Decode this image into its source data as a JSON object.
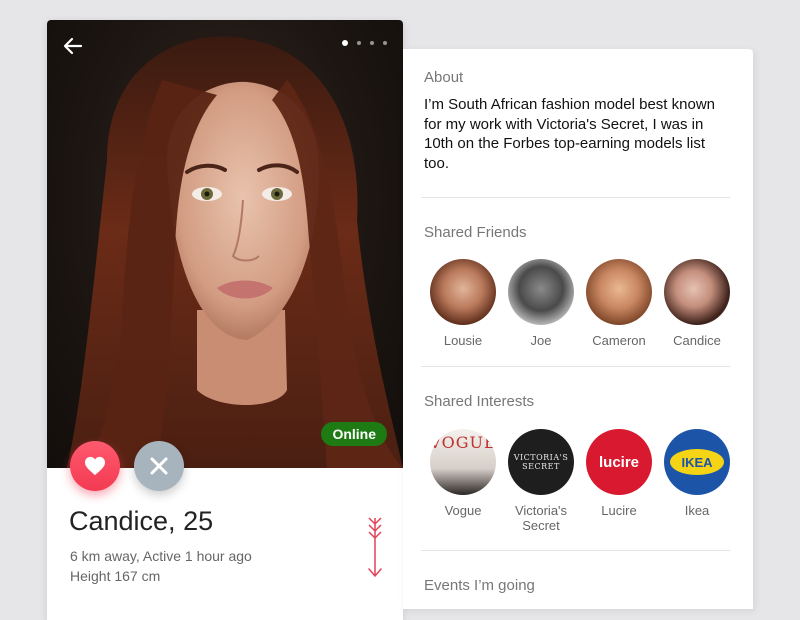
{
  "profile": {
    "name_age": "Candice, 25",
    "distance_activity": "6 km away, Active 1 hour ago",
    "height": "Height 167 cm",
    "status_badge": "Online",
    "photo_pages": 4,
    "active_page": 1
  },
  "about": {
    "title": "About",
    "text": "I’m South African fashion model best known for my work with Victoria's Secret, I was in 10th on the Forbes top-earning models list too."
  },
  "shared_friends": {
    "title": "Shared Friends",
    "items": [
      {
        "name": "Lousie"
      },
      {
        "name": "Joe"
      },
      {
        "name": "Cameron"
      },
      {
        "name": "Candice"
      }
    ]
  },
  "shared_interests": {
    "title": "Shared Interests",
    "items": [
      {
        "name": "Vogue",
        "logo_text": "VOGUE"
      },
      {
        "name": "Victoria's Secret",
        "logo_text_1": "VICTORIA'S",
        "logo_text_2": "SECRET"
      },
      {
        "name": "Lucire",
        "logo_text": "lucire"
      },
      {
        "name": "Ikea",
        "logo_text": "IKEA"
      }
    ]
  },
  "events": {
    "title": "Events I’m going"
  },
  "colors": {
    "like": "#f23a52",
    "dislike": "#a8b4bd",
    "online": "#1e7a12",
    "accent_arrow": "#e0435a"
  }
}
